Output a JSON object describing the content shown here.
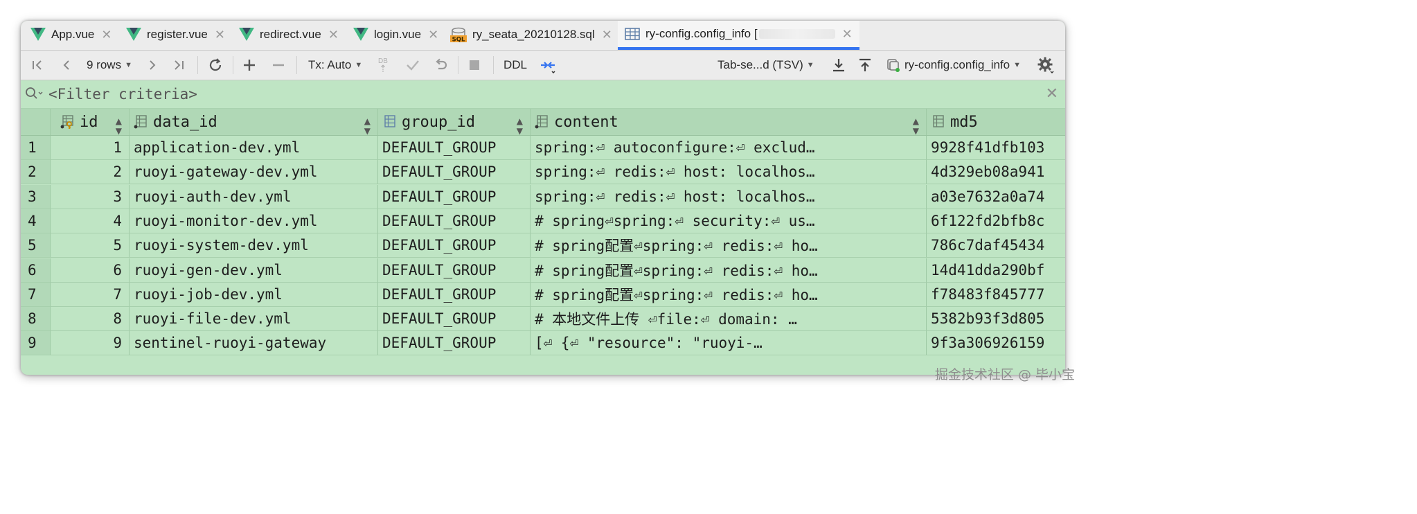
{
  "tabs": [
    {
      "label": "App.vue",
      "icon": "vue-icon",
      "active": false
    },
    {
      "label": "register.vue",
      "icon": "vue-icon",
      "active": false
    },
    {
      "label": "redirect.vue",
      "icon": "vue-icon",
      "active": false
    },
    {
      "label": "login.vue",
      "icon": "vue-icon",
      "active": false
    },
    {
      "label": "ry_seata_20210128.sql",
      "icon": "sql-file-icon",
      "active": false
    },
    {
      "label": "ry-config.config_info [",
      "icon": "table-icon",
      "active": true
    }
  ],
  "toolbar": {
    "rows_label": "9 rows",
    "tx_label": "Tx: Auto",
    "db_label": "DB",
    "ddl_label": "DDL",
    "format_label": "Tab-se...d (TSV)",
    "datasource_label": "ry-config.config_info"
  },
  "filter": {
    "placeholder": "<Filter criteria>"
  },
  "columns": [
    "id",
    "data_id",
    "group_id",
    "content",
    "md5"
  ],
  "rows": [
    {
      "n": "1",
      "id": "1",
      "data_id": "application-dev.yml",
      "group_id": "DEFAULT_GROUP",
      "content": "spring:⏎  autoconfigure:⏎    exclud…",
      "md5": "9928f41dfb103"
    },
    {
      "n": "2",
      "id": "2",
      "data_id": "ruoyi-gateway-dev.yml",
      "group_id": "DEFAULT_GROUP",
      "content": "spring:⏎  redis:⏎    host: localhos…",
      "md5": "4d329eb08a941"
    },
    {
      "n": "3",
      "id": "3",
      "data_id": "ruoyi-auth-dev.yml",
      "group_id": "DEFAULT_GROUP",
      "content": "spring:⏎  redis:⏎    host: localhos…",
      "md5": "a03e7632a0a74"
    },
    {
      "n": "4",
      "id": "4",
      "data_id": "ruoyi-monitor-dev.yml",
      "group_id": "DEFAULT_GROUP",
      "content": "# spring⏎spring:⏎  security:⏎    us…",
      "md5": "6f122fd2bfb8c"
    },
    {
      "n": "5",
      "id": "5",
      "data_id": "ruoyi-system-dev.yml",
      "group_id": "DEFAULT_GROUP",
      "content": "# spring配置⏎spring:⏎  redis:⏎    ho…",
      "md5": "786c7daf45434"
    },
    {
      "n": "6",
      "id": "6",
      "data_id": "ruoyi-gen-dev.yml",
      "group_id": "DEFAULT_GROUP",
      "content": "# spring配置⏎spring:⏎  redis:⏎    ho…",
      "md5": "14d41dda290bf"
    },
    {
      "n": "7",
      "id": "7",
      "data_id": "ruoyi-job-dev.yml",
      "group_id": "DEFAULT_GROUP",
      "content": "# spring配置⏎spring:⏎  redis:⏎    ho…",
      "md5": "f78483f845777"
    },
    {
      "n": "8",
      "id": "8",
      "data_id": "ruoyi-file-dev.yml",
      "group_id": "DEFAULT_GROUP",
      "content": "# 本地文件上传    ⏎file:⏎    domain: …",
      "md5": "5382b93f3d805"
    },
    {
      "n": "9",
      "id": "9",
      "data_id": "sentinel-ruoyi-gateway",
      "group_id": "DEFAULT_GROUP",
      "content": "[⏎    {⏎        \"resource\": \"ruoyi-…",
      "md5": "9f3a306926159"
    }
  ],
  "watermark": "掘金技术社区 @ 毕小宝",
  "colors": {
    "grid_bg": "#bfe5c4",
    "header_bg": "#b0d8b6",
    "active_tab_underline": "#3574f0",
    "vue_green": "#41b883"
  }
}
